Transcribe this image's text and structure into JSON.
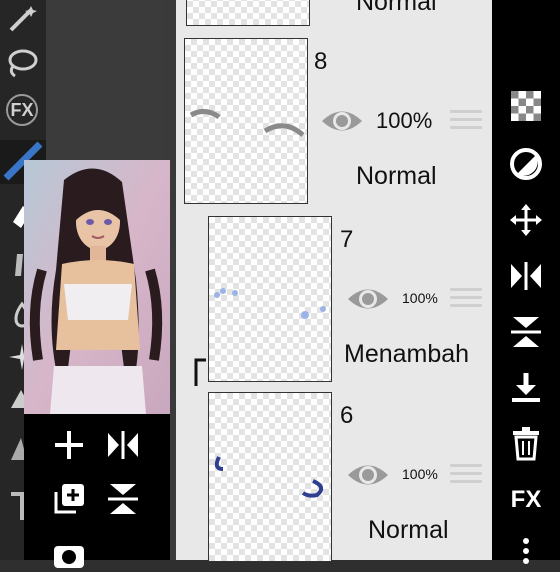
{
  "left_tools": {
    "fx_label": "FX"
  },
  "layers": [
    {
      "number": "",
      "opacity": "",
      "blend": "Normal"
    },
    {
      "number": "8",
      "opacity": "100%",
      "blend": "Normal"
    },
    {
      "number": "7",
      "opacity": "100%",
      "blend": "Menambah"
    },
    {
      "number": "6",
      "opacity": "100%",
      "blend": "Normal"
    }
  ],
  "right_bar": {
    "fx_label": "FX"
  },
  "colors": {
    "panel_bg": "#e8e8e8",
    "toolbar_bg": "#000000",
    "tool_strip_bg": "#262626",
    "canvas_bg": "#3b3b3b",
    "accent_blue": "#3a76c8"
  },
  "icons": [
    "lasso-icon",
    "fx-filter-icon",
    "pen-icon",
    "plus-icon",
    "flip-horizontal-icon",
    "duplicate-icon",
    "merge-down-icon",
    "camera-icon",
    "eye-icon",
    "menu-handle-icon",
    "checker-icon",
    "circle-half-icon",
    "move-icon",
    "flip-icon",
    "flip-vertical-icon",
    "download-icon",
    "trash-icon",
    "more-icon"
  ]
}
